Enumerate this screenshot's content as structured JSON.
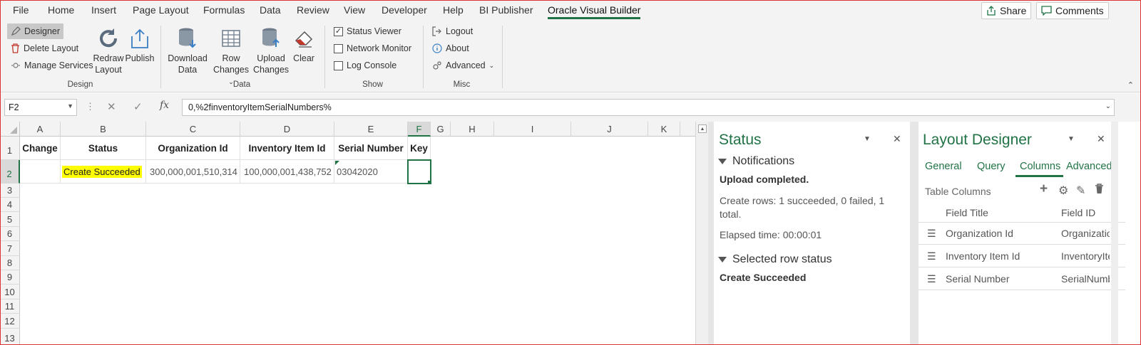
{
  "menu": {
    "items": [
      "File",
      "Home",
      "Insert",
      "Page Layout",
      "Formulas",
      "Data",
      "Review",
      "View",
      "Developer",
      "Help",
      "BI Publisher",
      "Oracle Visual Builder"
    ],
    "active_index": 11,
    "share_label": "Share",
    "comments_label": "Comments"
  },
  "ribbon": {
    "design": {
      "designer": "Designer",
      "delete_layout": "Delete Layout",
      "manage_services": "Manage Services",
      "redraw_1": "Redraw",
      "redraw_2": "Layout",
      "publish": "Publish",
      "label": "Design"
    },
    "data": {
      "download_1": "Download",
      "download_2": "Data",
      "row_1": "Row",
      "row_2": "Changes",
      "upload_1": "Upload",
      "upload_2": "Changes",
      "clear": "Clear",
      "label": "Data"
    },
    "show": {
      "status_viewer": "Status Viewer",
      "status_viewer_checked": true,
      "network_monitor": "Network Monitor",
      "log_console": "Log Console",
      "label": "Show"
    },
    "misc": {
      "logout": "Logout",
      "about": "About",
      "advanced": "Advanced",
      "label": "Misc"
    }
  },
  "formula_bar": {
    "name_box": "F2",
    "formula": "0,%2finventoryItemSerialNumbers%"
  },
  "grid": {
    "columns": [
      "A",
      "B",
      "C",
      "D",
      "E",
      "F",
      "G",
      "H",
      "I",
      "J",
      "K"
    ],
    "rows": [
      "1",
      "2",
      "3",
      "4",
      "5",
      "6",
      "7",
      "8",
      "9",
      "10",
      "11",
      "12",
      "13"
    ],
    "header_cells": [
      "Change",
      "Status",
      "Organization Id",
      "Inventory Item Id",
      "Serial Number",
      "Key"
    ],
    "row2": {
      "status": "Create Succeeded",
      "org_id": "300,000,001,510,314",
      "item_id": "100,000,001,438,752",
      "serial": "03042020",
      "key": ""
    }
  },
  "status_pane": {
    "title": "Status",
    "notifications_label": "Notifications",
    "upload_msg": "Upload completed.",
    "create_rows_1": "Create rows: 1 succeeded, 0 failed, 1",
    "create_rows_2": "total.",
    "elapsed": "Elapsed time: 00:00:01",
    "selected_row_label": "Selected row status",
    "selected_row_value": "Create Succeeded"
  },
  "layout_designer": {
    "title": "Layout Designer",
    "tabs": [
      "General",
      "Query",
      "Columns",
      "Advanced"
    ],
    "active_tab": 2,
    "table_columns_label": "Table Columns",
    "col_field_title": "Field Title",
    "col_field_id": "Field ID",
    "rows": [
      {
        "title": "Organization Id",
        "id": "OrganizationId"
      },
      {
        "title": "Inventory Item Id",
        "id": "InventoryItemId"
      },
      {
        "title": "Serial Number",
        "id": "SerialNumber"
      }
    ]
  },
  "colors": {
    "accent": "#217346",
    "highlight": "#ffff00"
  }
}
